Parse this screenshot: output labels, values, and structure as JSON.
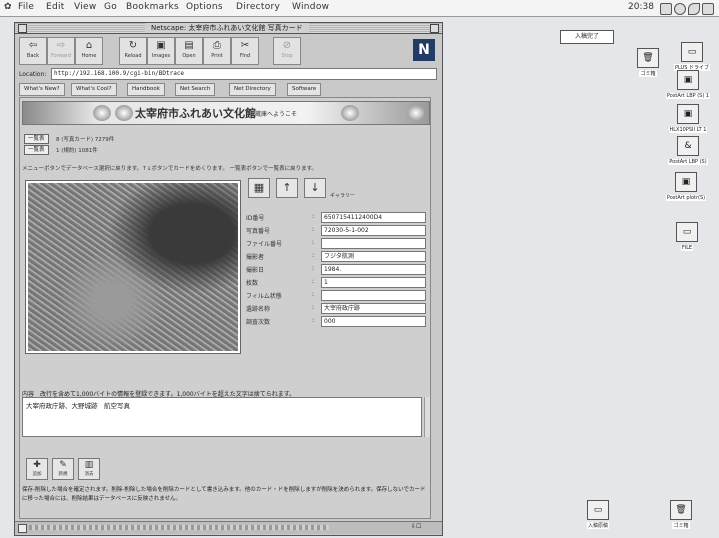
{
  "menubar": {
    "apple": "✿",
    "items": [
      "File",
      "Edit",
      "View",
      "Go",
      "Bookmarks",
      "Options",
      "Directory",
      "Window"
    ],
    "clock": "20:38"
  },
  "browser": {
    "title": "Netscape: 太宰府市ふれあい文化館 写真カード",
    "toolbar": [
      {
        "label": "Back",
        "icon": "⇦"
      },
      {
        "label": "Forward",
        "icon": "⇨"
      },
      {
        "label": "Home",
        "icon": "⌂"
      },
      {
        "label": "Reload",
        "icon": "↻"
      },
      {
        "label": "Images",
        "icon": "▣"
      },
      {
        "label": "Open",
        "icon": "▤"
      },
      {
        "label": "Print",
        "icon": "⎙"
      },
      {
        "label": "Find",
        "icon": "✂"
      },
      {
        "label": "Stop",
        "icon": "⊘"
      }
    ],
    "logo": "N",
    "location_label": "Location:",
    "location_url": "http://192.168.100.9/cgi-bin/BDtrace",
    "directory_buttons": [
      "What's New?",
      "What's Cool?",
      "Handbook",
      "Net Search",
      "Net Directory",
      "Software"
    ]
  },
  "page": {
    "banner_title": "太宰府市ふれあい文化館",
    "banner_subtitle": "収蔵庫へようこそ",
    "list_button_1": "一覧表",
    "list_text_1": "8 (写真カード) 7279件",
    "list_button_2": "一覧表",
    "list_text_2": "1 (規約) 1081件",
    "instruction": "メニューボタンでデータベース選択に戻ります。↑↓ボタンでカードをめくります。 一覧表ボタンで一覧表に戻ります。",
    "nav_note": "ギャラリー",
    "fields": [
      {
        "label": "ID番号",
        "value": "6507154112400D4"
      },
      {
        "label": "写真番号",
        "value": "72030-5-1-002"
      },
      {
        "label": "ファイル番号",
        "value": ""
      },
      {
        "label": "撮影者",
        "value": "フジタ航測"
      },
      {
        "label": "撮影日",
        "value": "1984."
      },
      {
        "label": "枚数",
        "value": "1"
      },
      {
        "label": "フィルム状態",
        "value": ""
      },
      {
        "label": "遺跡名称",
        "value": "大宰府政庁跡"
      },
      {
        "label": "調査次数",
        "value": "000"
      }
    ],
    "memo_label": "内容　改行を含めて1,000バイトの情報を登録できます。1,000バイトを超えた文字は捨てられます。",
    "memo_text": "大宰府政庁跡、大野城跡　航空写真",
    "actions": [
      {
        "label": "追加",
        "icon": "✚"
      },
      {
        "label": "新規",
        "icon": "✎"
      },
      {
        "label": "消去",
        "icon": "▥"
      }
    ],
    "footer_note": "保存-削除した場合を確定されます。削除-削除した場合を削除カードとして書き込みます。他のカード・ドを削除しますが削除を決められます。保存しないでカードに移った場合には、削除結果はデータベースに反映されません。"
  },
  "desktop": {
    "note_tag": "入稿完了",
    "icons": [
      {
        "name": "ゴミ箱",
        "glyph": "🗑"
      },
      {
        "name": "PLUS ドライブ",
        "glyph": "▭"
      },
      {
        "name": "PostArt LBP (S) 1",
        "glyph": "▣"
      },
      {
        "name": "HLX10PSII LT 1",
        "glyph": "▣"
      },
      {
        "name": "PostArt LBP (S)",
        "glyph": "&"
      },
      {
        "name": "PostArt plotr(S)",
        "glyph": "▣"
      },
      {
        "name": "FILE",
        "glyph": "▭"
      },
      {
        "name": "入稿原稿",
        "glyph": "▭"
      },
      {
        "name": "ゴミ箱",
        "glyph": "🗑"
      }
    ]
  }
}
